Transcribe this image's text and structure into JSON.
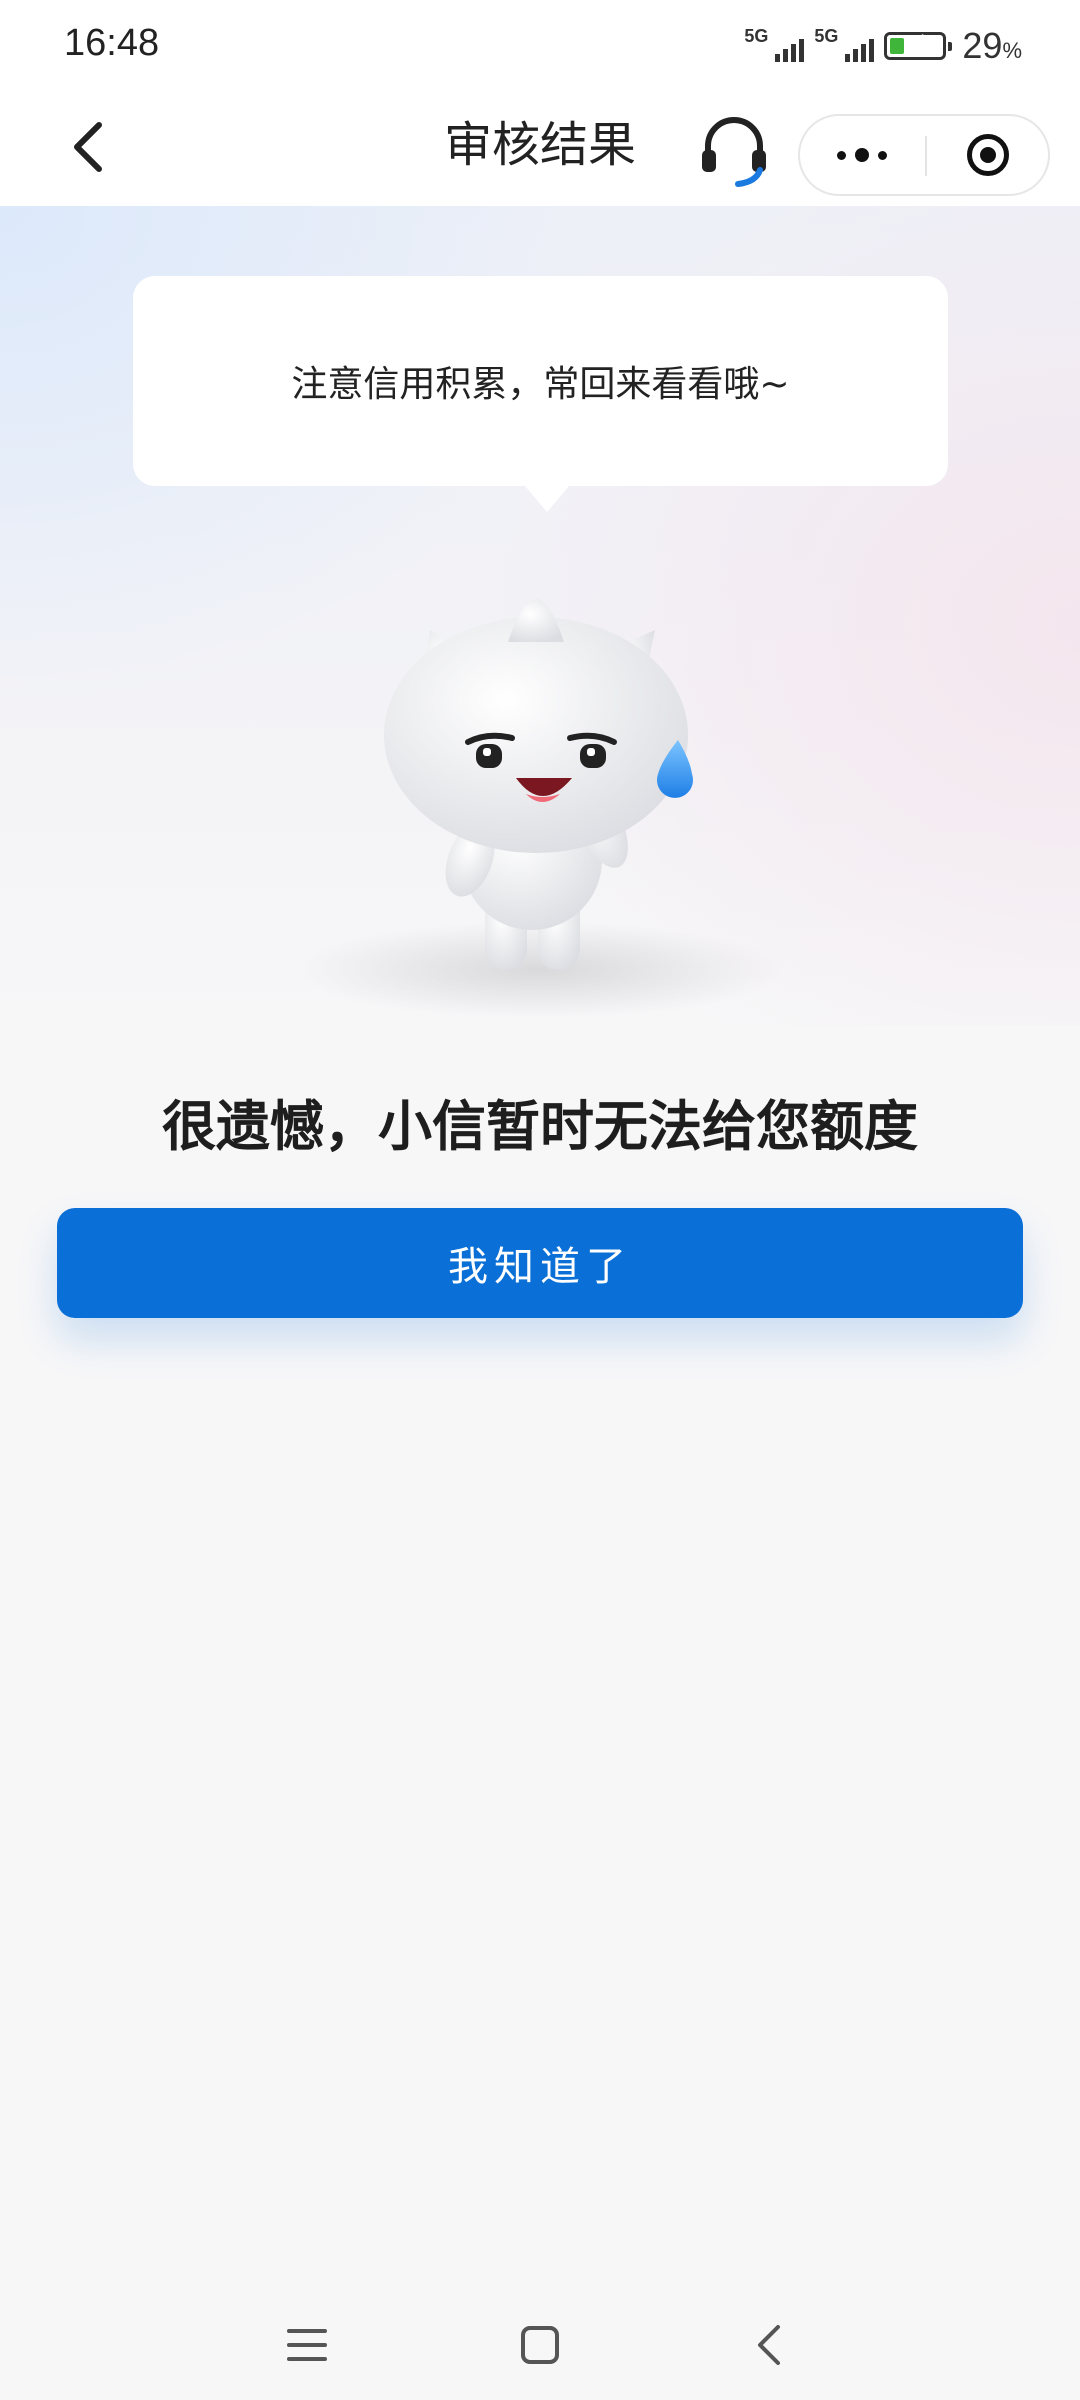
{
  "status_bar": {
    "time": "16:48",
    "network_1": "5G",
    "network_2": "5G",
    "battery_percent": "29",
    "battery_unit": "%",
    "battery_level": 0.29,
    "charging": true
  },
  "nav": {
    "back_icon": "chevron-left-icon",
    "title": "审核结果",
    "support_icon": "headset-icon",
    "more_icon": "more-dots-icon",
    "close_icon": "target-circle-icon"
  },
  "bubble": {
    "text": "注意信用积累，常回来看看哦~"
  },
  "mascot": {
    "icon": "cat-mascot-sweat-icon"
  },
  "result": {
    "headline": "很遗憾，小信暂时无法给您额度"
  },
  "actions": {
    "confirm_label": "我知道了"
  },
  "system_nav": {
    "menu_icon": "menu-icon",
    "home_icon": "home-square-icon",
    "back_icon": "back-triangle-icon"
  },
  "colors": {
    "primary": "#0a6fd6",
    "background": "#f7f7f8",
    "battery_green": "#3fb53a",
    "sweat_blue": "#2f8ff0",
    "headset_blue": "#1a7ae0"
  }
}
